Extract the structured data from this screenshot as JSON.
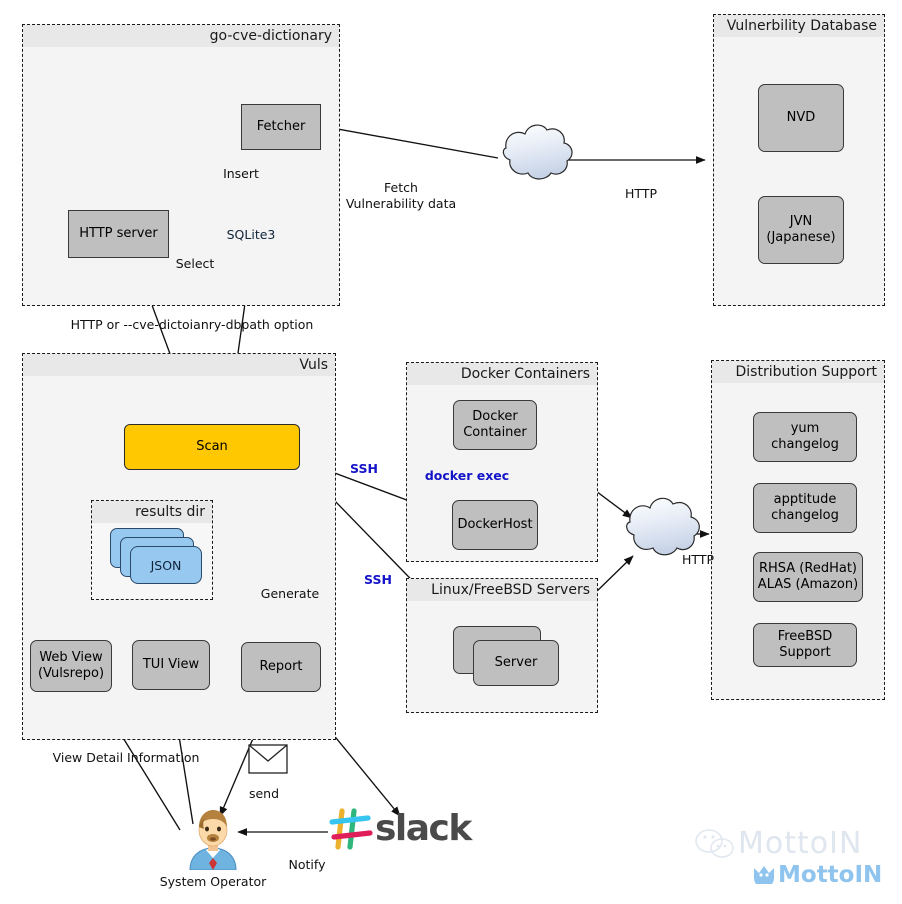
{
  "diagram": {
    "title": "Vuls architecture diagram",
    "colors": {
      "node_gray": "#bfbfbf",
      "node_amber": "#ffc800",
      "node_blue": "#96c8f0",
      "panel_fill": "#f4f4f4",
      "panel_header": "#e8e8e8",
      "ssh_label": "#1414c8",
      "cloud_fill": "#dfe6f2"
    }
  },
  "panels": {
    "go_cve_dictionary": {
      "title": "go-cve-dictionary"
    },
    "vulnerability_database": {
      "title": "Vulnerbility Database"
    },
    "vuls": {
      "title": "Vuls"
    },
    "results_dir": {
      "title": "results dir"
    },
    "docker_containers": {
      "title": "Docker Containers"
    },
    "linux_freebsd_servers": {
      "title": "Linux/FreeBSD Servers"
    },
    "distribution_support": {
      "title": "Distribution Support"
    }
  },
  "nodes": {
    "fetcher": "Fetcher",
    "http_server": "HTTP server",
    "sqlite3": "SQLite3",
    "nvd": "NVD",
    "jvn": "JVN\n(Japanese)",
    "scan": "Scan",
    "json": "JSON",
    "web_view": "Web View\n(Vulsrepo)",
    "tui_view": "TUI View",
    "report": "Report",
    "docker_container": "Docker\nContainer",
    "docker_host": "DockerHost",
    "server": "Server",
    "yum_changelog": "yum\nchangelog",
    "apptitude_changelog": "apptitude\nchangelog",
    "rhsa_alas": "RHSA (RedHat)\nALAS (Amazon)",
    "freebsd_support": "FreeBSD Support"
  },
  "edge_labels": {
    "insert": "Insert",
    "select": "Select",
    "fetch_vulnerability_data": "Fetch\nVulnerability data",
    "http_top": "HTTP",
    "http_or_dbpath": "HTTP or --cve-dictoianry-dbpath option",
    "ssh_docker": "SSH",
    "ssh_servers": "SSH",
    "docker_exec": "docker exec",
    "generate": "Generate",
    "http_right": "HTTP",
    "view_detail_information": "View Detail Information",
    "send": "send",
    "notify": "Notify"
  },
  "actors": {
    "system_operator": "System Operator"
  },
  "logos": {
    "slack": "slack",
    "watermark_top": "MottoIN",
    "watermark_bottom": "MottoIN"
  }
}
